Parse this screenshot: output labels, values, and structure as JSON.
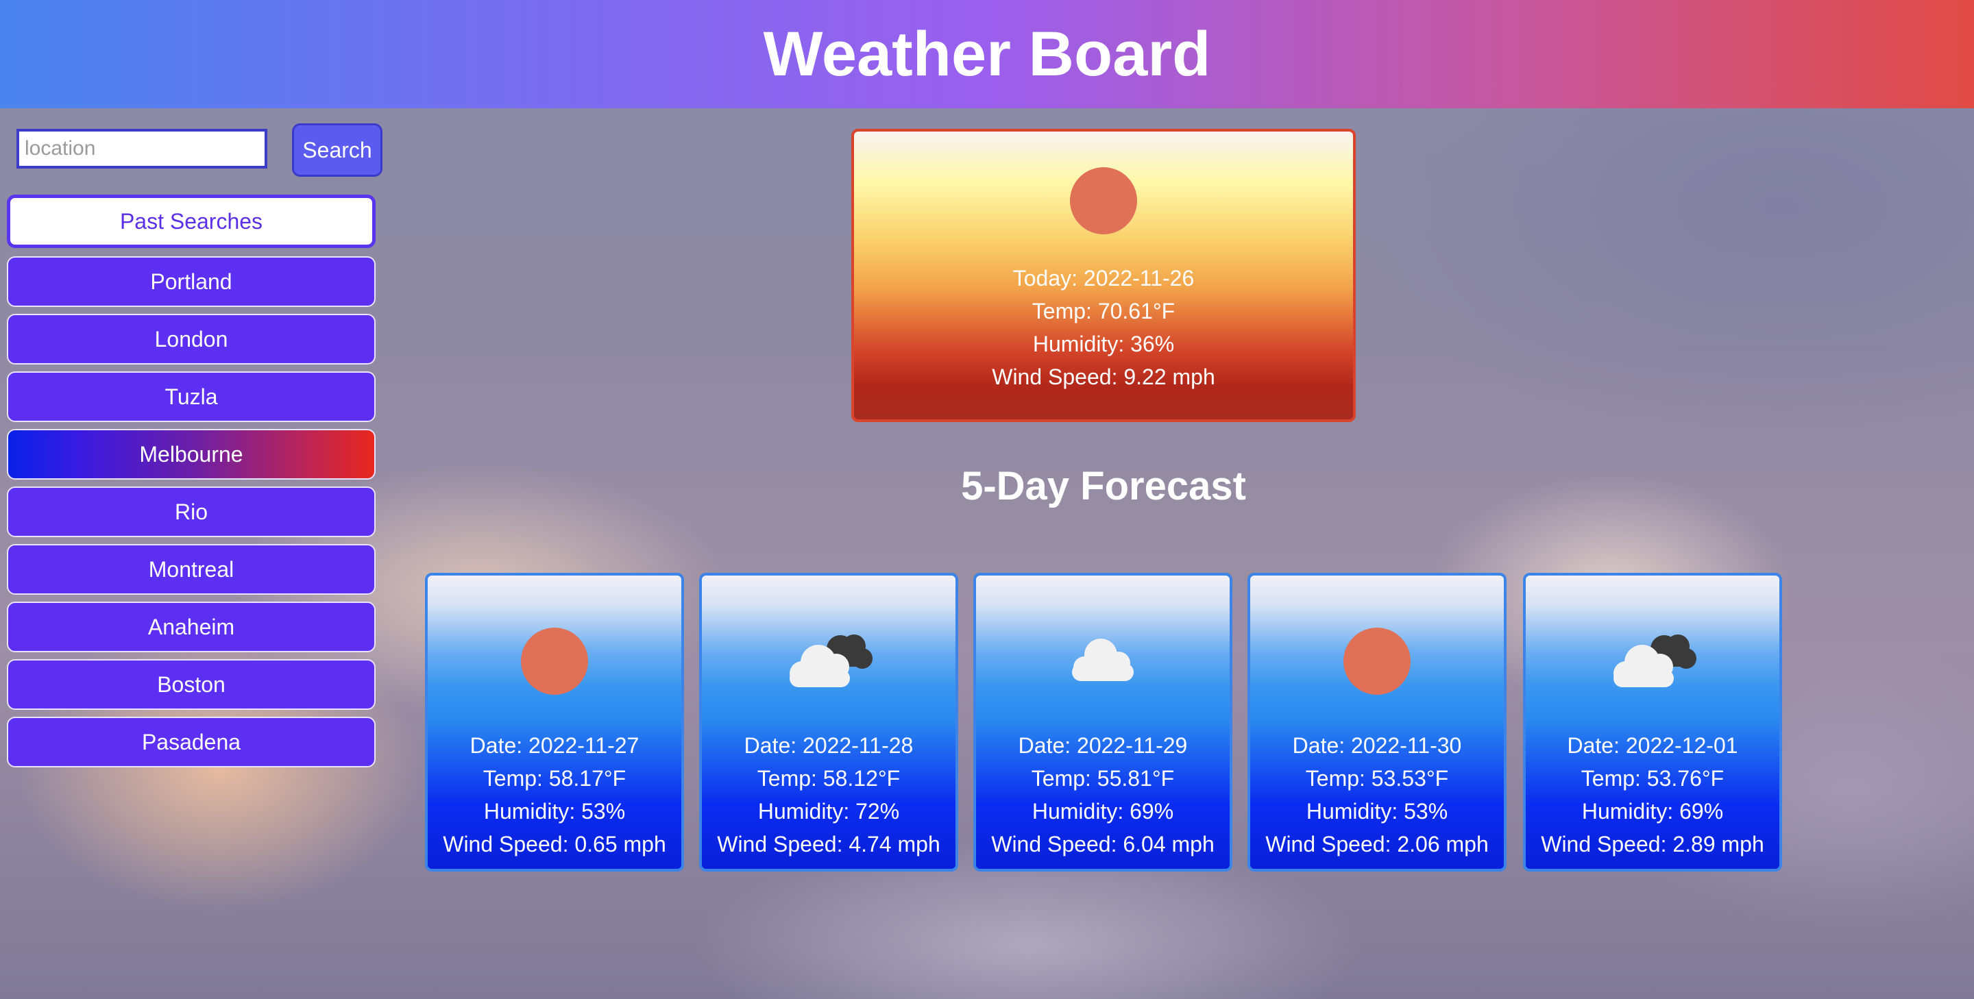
{
  "header": {
    "title": "Weather Board"
  },
  "search": {
    "placeholder": "location",
    "button_label": "Search"
  },
  "past_searches": {
    "title": "Past Searches",
    "cities": [
      "Portland",
      "London",
      "Tuzla",
      "Melbourne",
      "Rio",
      "Montreal",
      "Anaheim",
      "Boston",
      "Pasadena"
    ],
    "active": "Melbourne"
  },
  "today": {
    "icon": "sun-icon",
    "date": "Today: 2022-11-26",
    "temp": "Temp: 70.61°F",
    "humidity": "Humidity: 36%",
    "wind": "Wind Speed: 9.22 mph"
  },
  "forecast": {
    "title": "5-Day Forecast",
    "days": [
      {
        "icon": "sun-icon",
        "date": "Date: 2022-11-27",
        "temp": "Temp: 58.17°F",
        "humidity": "Humidity: 53%",
        "wind": "Wind Speed: 0.65 mph"
      },
      {
        "icon": "broken-clouds-icon",
        "date": "Date: 2022-11-28",
        "temp": "Temp: 58.12°F",
        "humidity": "Humidity: 72%",
        "wind": "Wind Speed: 4.74 mph"
      },
      {
        "icon": "cloud-icon",
        "date": "Date: 2022-11-29",
        "temp": "Temp: 55.81°F",
        "humidity": "Humidity: 69%",
        "wind": "Wind Speed: 6.04 mph"
      },
      {
        "icon": "sun-icon",
        "date": "Date: 2022-11-30",
        "temp": "Temp: 53.53°F",
        "humidity": "Humidity: 53%",
        "wind": "Wind Speed: 2.06 mph"
      },
      {
        "icon": "broken-clouds-icon",
        "date": "Date: 2022-12-01",
        "temp": "Temp: 53.76°F",
        "humidity": "Humidity: 69%",
        "wind": "Wind Speed: 2.89 mph"
      }
    ]
  }
}
